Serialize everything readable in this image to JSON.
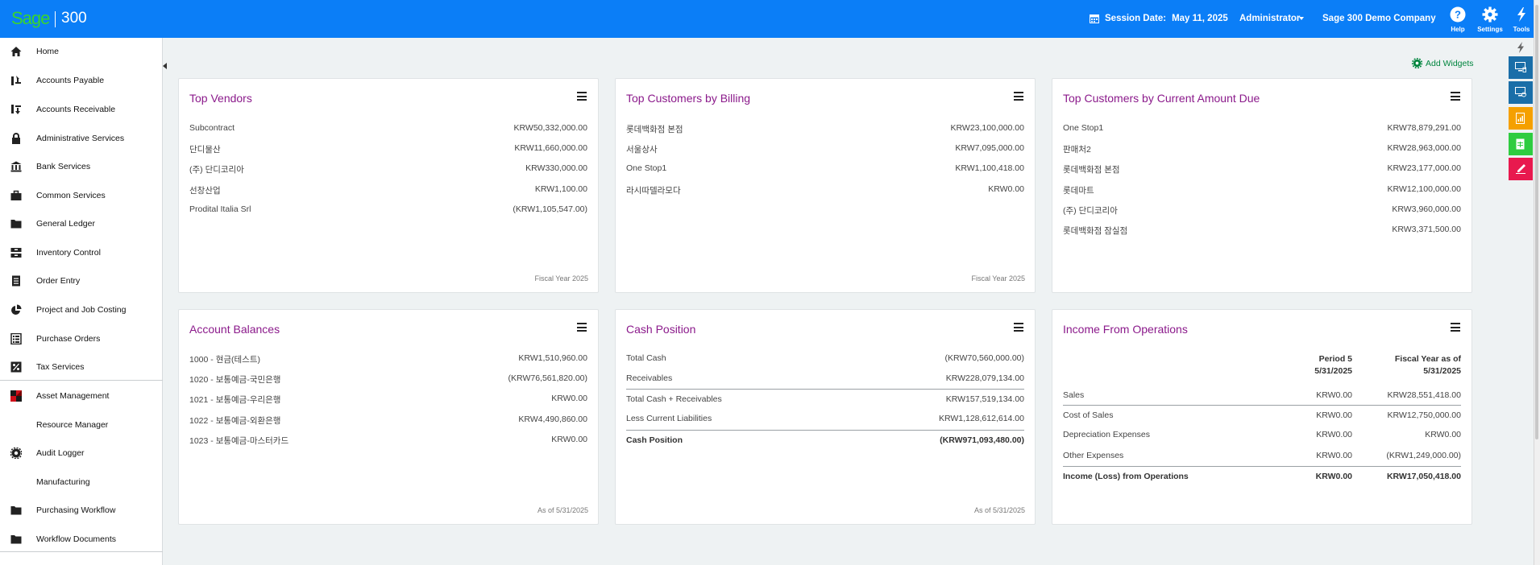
{
  "header": {
    "logo_text": "Sage",
    "product": "300",
    "session_label": "Session Date:",
    "session_date": "May 11, 2025",
    "user": "Administrator",
    "company": "Sage 300 Demo Company",
    "help_label": "Help",
    "settings_label": "Settings",
    "tools_label": "Tools",
    "add_widgets": "Add Widgets",
    "brand_color": "#0b7ef7",
    "logo_color": "#38d430"
  },
  "sidebar": {
    "items": [
      {
        "label": "Home",
        "icon": "home-icon"
      },
      {
        "label": "Accounts Payable",
        "icon": "accounts-payable-icon"
      },
      {
        "label": "Accounts Receivable",
        "icon": "accounts-receivable-icon"
      },
      {
        "label": "Administrative Services",
        "icon": "lock-icon"
      },
      {
        "label": "Bank Services",
        "icon": "bank-icon"
      },
      {
        "label": "Common Services",
        "icon": "briefcase-icon"
      },
      {
        "label": "General Ledger",
        "icon": "folder-icon"
      },
      {
        "label": "Inventory Control",
        "icon": "inventory-icon"
      },
      {
        "label": "Order Entry",
        "icon": "document-icon"
      },
      {
        "label": "Project and Job Costing",
        "icon": "pie-chart-icon"
      },
      {
        "label": "Purchase Orders",
        "icon": "grid-list-icon"
      },
      {
        "label": "Tax Services",
        "icon": "percent-icon"
      },
      {
        "label": "Asset Management",
        "icon": "asset-management-icon"
      },
      {
        "label": "Resource Manager",
        "icon": ""
      },
      {
        "label": "Audit Logger",
        "icon": "gear-icon"
      },
      {
        "label": "Manufacturing",
        "icon": ""
      },
      {
        "label": "Purchasing Workflow",
        "icon": "folder-icon"
      },
      {
        "label": "Workflow Documents",
        "icon": "folder-icon"
      }
    ]
  },
  "widgets": {
    "top_vendors": {
      "title": "Top Vendors",
      "rows": [
        {
          "k": "Subcontract",
          "v": "KRW50,332,000.00"
        },
        {
          "k": "단디물산",
          "v": "KRW11,660,000.00"
        },
        {
          "k": "(주) 단디코리아",
          "v": "KRW330,000.00"
        },
        {
          "k": "선창산업",
          "v": "KRW1,100.00"
        },
        {
          "k": "Prodital Italia Srl",
          "v": "(KRW1,105,547.00)"
        }
      ],
      "footer": "Fiscal Year 2025"
    },
    "top_customers_billing": {
      "title": "Top Customers by Billing",
      "rows": [
        {
          "k": "롯데백화점 본점",
          "v": "KRW23,100,000.00"
        },
        {
          "k": "서울상사",
          "v": "KRW7,095,000.00"
        },
        {
          "k": "One Stop1",
          "v": "KRW1,100,418.00"
        },
        {
          "k": "라시따델라모다",
          "v": "KRW0.00"
        }
      ],
      "footer": "Fiscal Year 2025"
    },
    "top_customers_due": {
      "title": "Top Customers by Current Amount Due",
      "rows": [
        {
          "k": "One Stop1",
          "v": "KRW78,879,291.00"
        },
        {
          "k": "판매처2",
          "v": "KRW28,963,000.00"
        },
        {
          "k": "롯데백화점 본점",
          "v": "KRW23,177,000.00"
        },
        {
          "k": "롯데마트",
          "v": "KRW12,100,000.00"
        },
        {
          "k": "(주) 단디코리아",
          "v": "KRW3,960,000.00"
        },
        {
          "k": "롯데백화점 잠실점",
          "v": "KRW3,371,500.00"
        }
      ]
    },
    "account_balances": {
      "title": "Account Balances",
      "rows": [
        {
          "k": "1000 - 현금(테스트)",
          "v": "KRW1,510,960.00"
        },
        {
          "k": "1020 - 보통예금-국민은행",
          "v": "(KRW76,561,820.00)"
        },
        {
          "k": "1021 - 보통예금-우리은행",
          "v": "KRW0.00"
        },
        {
          "k": "1022 - 보통예금-외환은행",
          "v": "KRW4,490,860.00"
        },
        {
          "k": "1023 - 보통예금-마스터카드",
          "v": "KRW0.00"
        }
      ],
      "footer": "As of 5/31/2025"
    },
    "cash_position": {
      "title": "Cash Position",
      "rows": [
        {
          "k": "Total Cash",
          "v": "(KRW70,560,000.00)"
        },
        {
          "k": "Receivables",
          "v": "KRW228,079,134.00"
        },
        {
          "k": "Total Cash + Receivables",
          "v": "KRW157,519,134.00"
        },
        {
          "k": "Less Current Liabilities",
          "v": "KRW1,128,612,614.00"
        },
        {
          "k": "Cash Position",
          "v": "(KRW971,093,480.00)"
        }
      ],
      "footer": "As of 5/31/2025"
    },
    "income_ops": {
      "title": "Income From Operations",
      "col1_line1": "Period  5",
      "col1_line2": "5/31/2025",
      "col2_line1": "Fiscal Year as of",
      "col2_line2": "5/31/2025",
      "rows": [
        {
          "k": "Sales",
          "p": "KRW0.00",
          "f": "KRW28,551,418.00"
        },
        {
          "k": "Cost of Sales",
          "p": "KRW0.00",
          "f": "KRW12,750,000.00"
        },
        {
          "k": "Depreciation Expenses",
          "p": "KRW0.00",
          "f": "KRW0.00"
        },
        {
          "k": "Other Expenses",
          "p": "KRW0.00",
          "f": "(KRW1,249,000.00)"
        },
        {
          "k": "Income (Loss) from Operations",
          "p": "KRW0.00",
          "f": "KRW17,050,418.00"
        }
      ]
    }
  },
  "right_rail": {
    "colors": [
      "#1a6ea8",
      "#1a6ea8",
      "#f5a000",
      "#2ecc40",
      "#e8194e"
    ]
  }
}
